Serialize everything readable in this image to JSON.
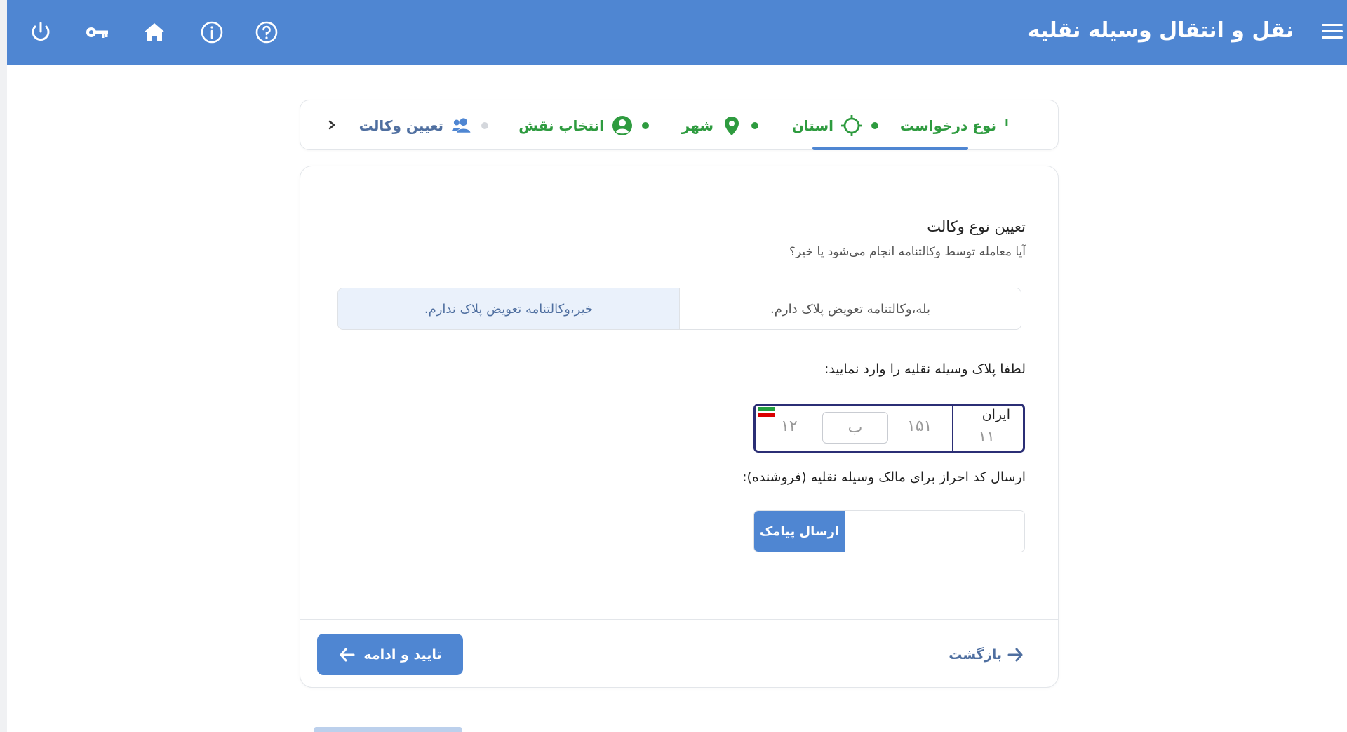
{
  "header": {
    "title": "نقل و انتقال وسیله نقلیه",
    "icons": [
      "power-icon",
      "key-icon",
      "home-icon",
      "info-icon",
      "help-icon",
      "menu-icon"
    ],
    "color": "#4f86d2"
  },
  "stepper": {
    "steps": [
      {
        "label": "نوع درخواست",
        "status": "done"
      },
      {
        "label": "استان",
        "status": "active"
      },
      {
        "label": "شهر",
        "status": "done"
      },
      {
        "label": "انتخاب نقش",
        "status": "done"
      },
      {
        "label": "تعیین وکالت",
        "status": "pending"
      }
    ],
    "kebab": "⁝"
  },
  "form": {
    "title": "تعیین نوع وکالت",
    "subtitle": "آیا معامله توسط وکالتنامه انجام می‌شود یا خیر؟",
    "options": {
      "yes": "بله،وکالتنامه تعویض پلاک دارم.",
      "no": "خیر،وکالتنامه تعویض پلاک ندارم."
    },
    "plate_label": "لطفا پلاک وسیله نقلیه را وارد نمایید:",
    "plate": {
      "iran_label": "ایران",
      "region_code": "۱۱",
      "three_digits": "۱۵۱",
      "letter": "ب",
      "two_digits": "۱۲"
    },
    "sms_label": "ارسال کد احراز برای مالک وسیله نقلیه (فروشنده):",
    "sms_button": "ارسال پیامک",
    "sms_input_value": ""
  },
  "footer": {
    "confirm_label": "تایید و ادامه",
    "back_label": "بازگشت"
  }
}
